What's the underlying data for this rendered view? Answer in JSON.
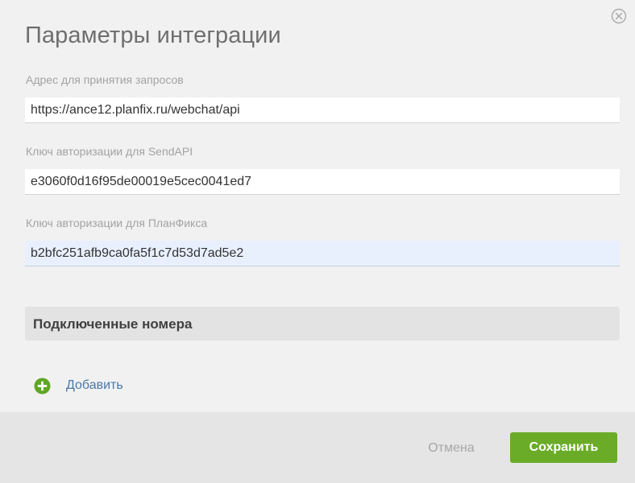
{
  "dialog": {
    "title": "Параметры интеграции",
    "close_icon": "close-circle-icon"
  },
  "fields": [
    {
      "label": "Адрес для принятия запросов",
      "value": "https://ance12.planfix.ru/webchat/api"
    },
    {
      "label": "Ключ авторизации для SendAPI",
      "value": "e3060f0d16f95de00019e5cec0041ed7"
    },
    {
      "label": "Ключ авторизации для ПланФикса",
      "value": "b2bfc251afb9ca0fa5f1c7d53d7ad5e2"
    }
  ],
  "connected_numbers": {
    "title": "Подключенные номера",
    "add_label": "Добавить",
    "add_icon": "plus-circle-icon"
  },
  "footer": {
    "cancel_label": "Отмена",
    "save_label": "Сохранить"
  },
  "colors": {
    "accent_green": "#6aac27",
    "link_blue": "#4a78a8",
    "focused_field_bg": "#e8f0fe"
  }
}
